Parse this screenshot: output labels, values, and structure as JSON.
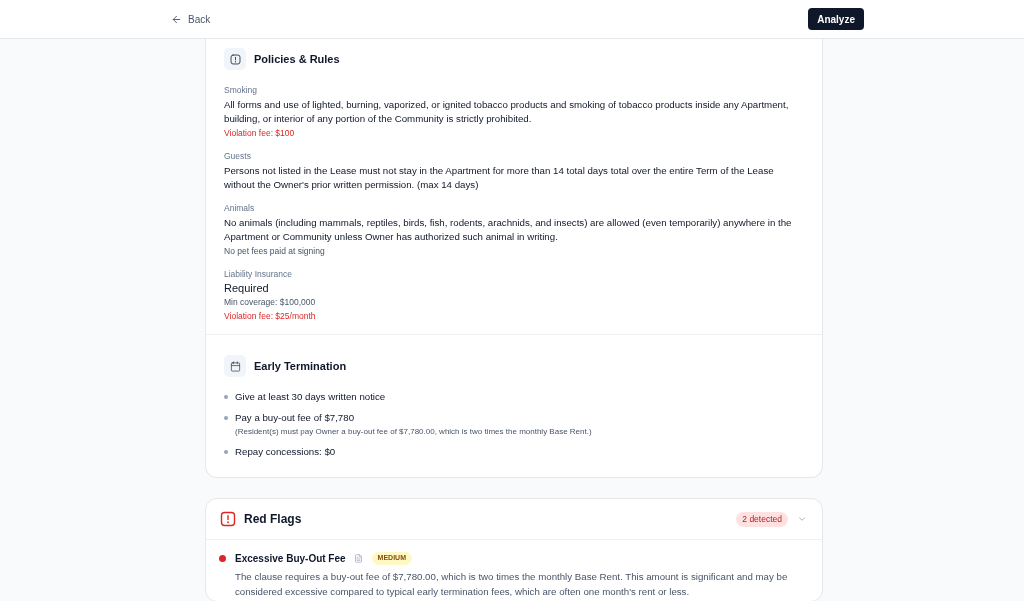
{
  "header": {
    "back": "Back",
    "analyze": "Analyze"
  },
  "policies": {
    "title": "Policies & Rules",
    "items": [
      {
        "label": "Smoking",
        "kind": "paragraph",
        "text": "All forms and use of lighted, burning, vaporized, or ignited tobacco products and smoking of tobacco products inside any Apartment, building, or interior of any portion of the Community is strictly prohibited.",
        "notes": [
          {
            "kind": "fee",
            "text": "Violation fee: $100"
          }
        ]
      },
      {
        "label": "Guests",
        "kind": "paragraph",
        "text": "Persons not listed in the Lease must not stay in the Apartment for more than 14 total days total over the entire Term of the Lease without the Owner's prior written permission. (max 14 days)"
      },
      {
        "label": "Animals",
        "kind": "paragraph",
        "text": "No animals (including mammals, reptiles, birds, fish, rodents, arachnids, and insects) are allowed (even temporarily) anywhere in the Apartment or Community unless Owner has authorized such animal in writing.",
        "notes": [
          {
            "kind": "note",
            "text": "No pet fees paid at signing"
          }
        ]
      },
      {
        "label": "Liability Insurance",
        "kind": "value",
        "text": "Required",
        "notes": [
          {
            "kind": "note",
            "text": "Min coverage: $100,000"
          },
          {
            "kind": "fee",
            "text": "Violation fee: $25/month"
          }
        ]
      }
    ]
  },
  "early_termination": {
    "title": "Early Termination",
    "items": [
      {
        "text": "Give at least 30 days written notice"
      },
      {
        "text": "Pay a buy-out fee of $7,780",
        "detail": "(Resident(s) must pay Owner a buy-out fee of $7,780.00, which is two times the monthly Base Rent.)"
      },
      {
        "text": "Repay concessions: $0"
      }
    ]
  },
  "red_flags": {
    "title": "Red Flags",
    "count": "2 detected",
    "expanded": true,
    "flags": [
      {
        "title": "Excessive Buy-Out Fee",
        "color": "#dc2626",
        "severity": {
          "kind": "medium",
          "label": "MEDIUM"
        },
        "description": "The clause requires a buy-out fee of $7,780.00, which is two times the monthly Base Rent. This amount is significant and may be considered excessive compared to typical early termination fees, which are often one month's rent or less."
      }
    ]
  }
}
